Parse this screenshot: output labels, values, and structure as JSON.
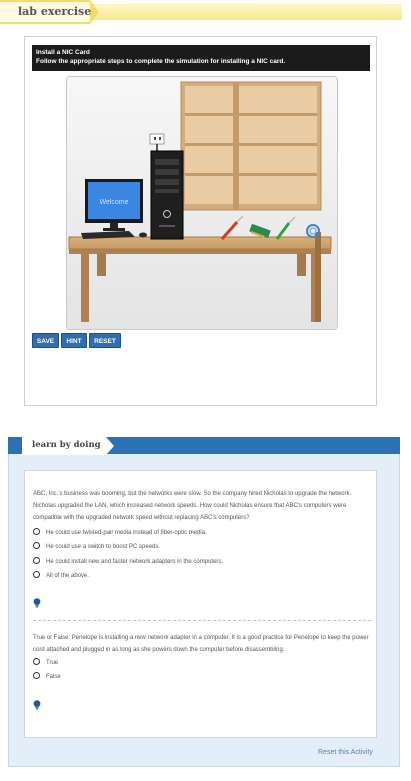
{
  "lab": {
    "header_label": "lab exercise",
    "instruction_title": "Install a NIC Card",
    "instruction_body": "Follow the appropriate steps to complete the simulation for installing a NIC card.",
    "monitor_text": "Welcome",
    "buttons": {
      "save": "SAVE",
      "hint": "HINT",
      "reset": "RESET"
    }
  },
  "learn": {
    "header_label": "learn by doing",
    "questions": [
      {
        "text": "ABC, Inc.'s business was booming, but the networks were slow. So the company hired Nicholas to upgrade the network. Nicholas upgraded the LAN, which increased network speeds. How could Nicholas ensure that ABC's computers were compatible with the upgraded network speed without replacing ABC's computers?",
        "options": [
          "He could use twisted-pair media instead of fiber-optic media.",
          "He could use a switch to boost PC speeds.",
          "He could install new and faster network adapters in the computers.",
          "All of the above."
        ]
      },
      {
        "text": "True or False: Penelope is installing a new network adapter in a computer. It is a good practice for Penelope to keep the power cord attached and plugged in as long as she powers down the computer before disassembling.",
        "options": [
          "True",
          "False"
        ]
      }
    ],
    "reset_label": "Reset this Activity"
  }
}
